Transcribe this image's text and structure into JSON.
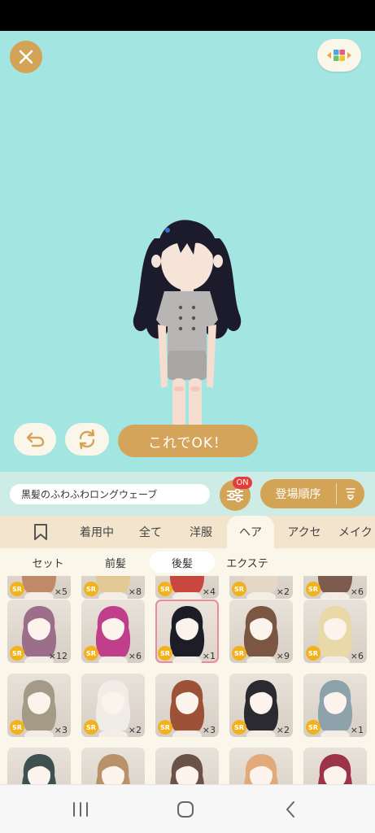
{
  "actions": {
    "ok_label": "これでOK！"
  },
  "item": {
    "name": "黒髪のふわふわロングウェーブ"
  },
  "filter": {
    "badge": "ON"
  },
  "sort": {
    "label": "登場順序"
  },
  "tabs": [
    {
      "label": "着用中"
    },
    {
      "label": "全て"
    },
    {
      "label": "洋服"
    },
    {
      "label": "ヘア",
      "active": true
    },
    {
      "label": "アクセ"
    },
    {
      "label": "メイク"
    }
  ],
  "subtabs": [
    {
      "label": "セット"
    },
    {
      "label": "前髪"
    },
    {
      "label": "後髪",
      "active": true
    },
    {
      "label": "エクステ"
    }
  ],
  "items": [
    {
      "rarity": "SR",
      "count": "×5",
      "hair": "#c08a6a"
    },
    {
      "rarity": "SR",
      "count": "×8",
      "hair": "#e3c995"
    },
    {
      "rarity": "SR",
      "count": "×4",
      "hair": "#c8473f"
    },
    {
      "rarity": "SR",
      "count": "×2",
      "hair": "#e6d8c6"
    },
    {
      "rarity": "SR",
      "count": "×6",
      "hair": "#7d5b4e"
    },
    {
      "rarity": "SR",
      "count": "×12",
      "hair": "#9b6f8a"
    },
    {
      "rarity": "SR",
      "count": "×6",
      "hair": "#c13f8a"
    },
    {
      "rarity": "SR",
      "count": "×1",
      "hair": "#1d1d28"
    },
    {
      "rarity": "SR",
      "count": "×9",
      "hair": "#7b5643"
    },
    {
      "rarity": "SR",
      "count": "×6",
      "hair": "#e9d9a8"
    },
    {
      "rarity": "SR",
      "count": "×3",
      "hair": "#a49a86"
    },
    {
      "rarity": "SR",
      "count": "×2",
      "hair": "#f0ede6"
    },
    {
      "rarity": "SR",
      "count": "×3",
      "hair": "#9d5238"
    },
    {
      "rarity": "SR",
      "count": "×2",
      "hair": "#2a2a30"
    },
    {
      "rarity": "SR",
      "count": "×1",
      "hair": "#8ea2ac"
    },
    {
      "rarity": "",
      "count": "",
      "hair": "#3e5150"
    },
    {
      "rarity": "",
      "count": "",
      "hair": "#b89268"
    },
    {
      "rarity": "",
      "count": "",
      "hair": "#6b5248"
    },
    {
      "rarity": "",
      "count": "",
      "hair": "#e2a97a"
    },
    {
      "rarity": "",
      "count": "",
      "hair": "#9d3348"
    }
  ],
  "colors": {
    "stage_bg": "#a3e5e1",
    "gold": "#d3a456",
    "cream": "#fbf6ea",
    "tab_bg": "#f3e4cd",
    "badge_red": "#e53b3b",
    "rarity": "#f2b21c",
    "selected_outline": "#e98c9c"
  }
}
